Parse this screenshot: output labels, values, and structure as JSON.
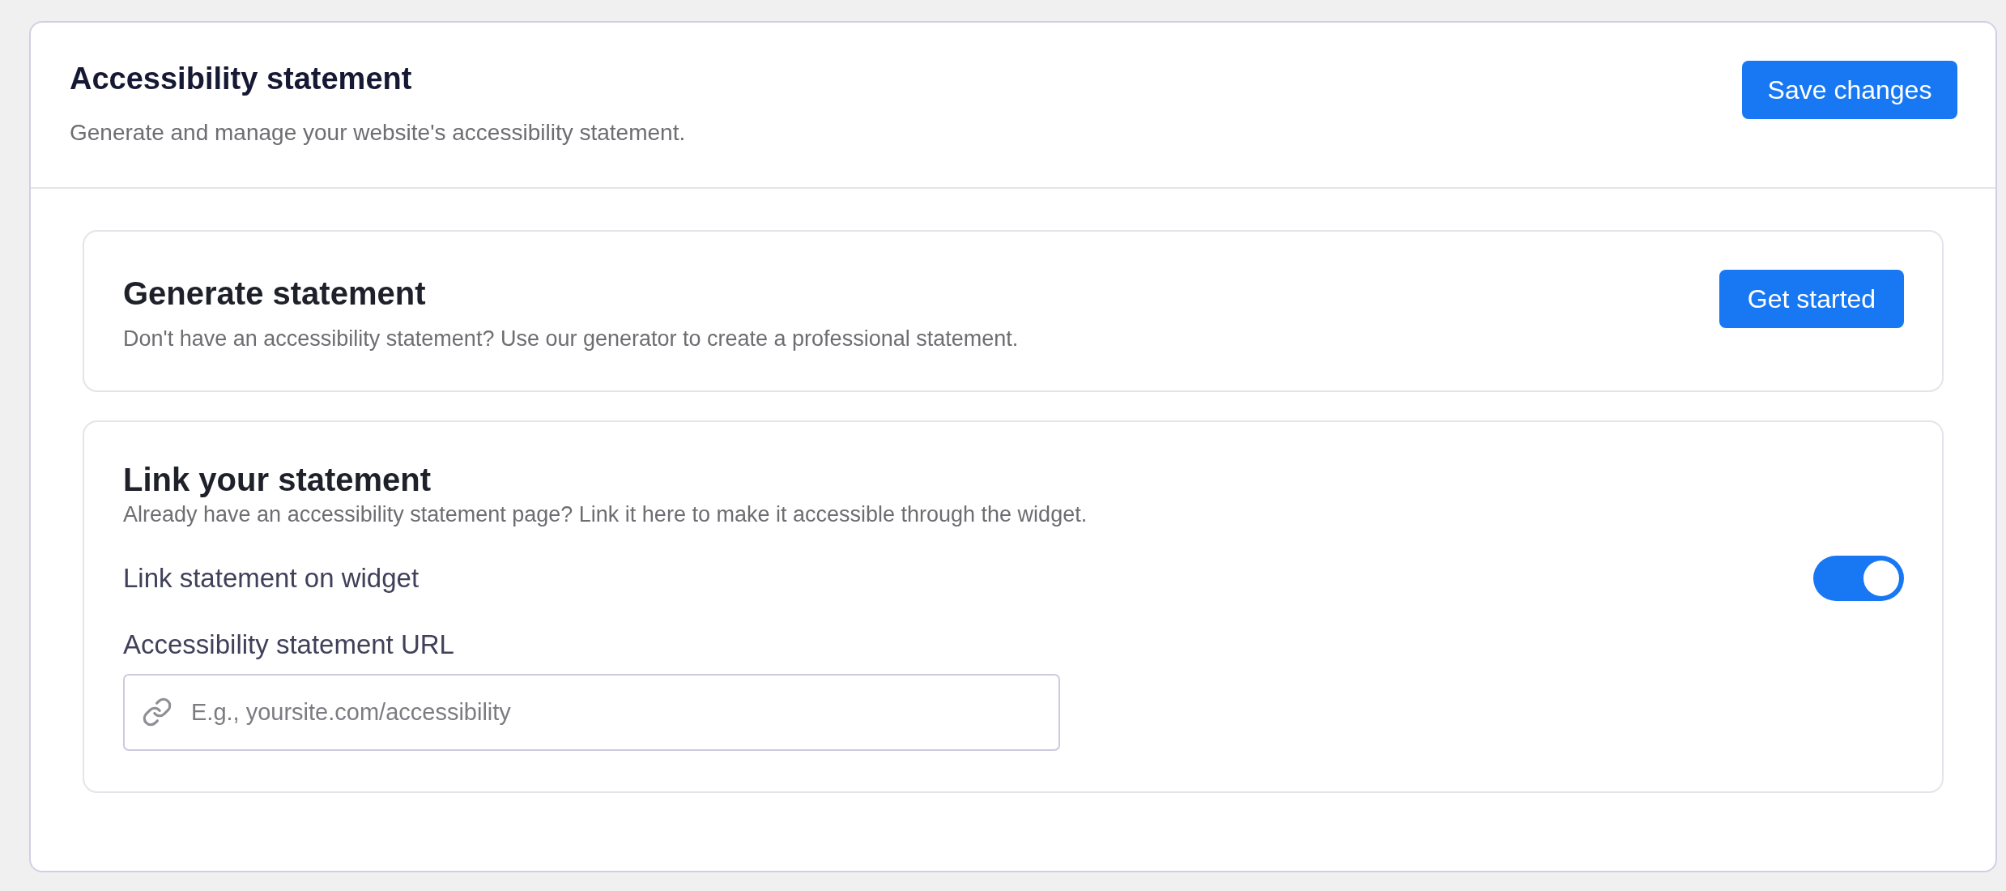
{
  "header": {
    "title": "Accessibility statement",
    "subtitle": "Generate and manage your website's accessibility statement.",
    "save_button": "Save changes"
  },
  "sections": [
    {
      "kind": "action",
      "title": "Generate statement",
      "description": "Don't have an accessibility statement? Use our generator to create a professional statement.",
      "button": "Get started"
    },
    {
      "kind": "link",
      "title": "Link your statement",
      "description": "Already have an accessibility statement page? Link it here to make it accessible through the widget.",
      "toggle": {
        "label": "Link statement on widget",
        "on": true
      },
      "url_field": {
        "label": "Accessibility statement URL",
        "placeholder": "E.g., yoursite.com/accessibility"
      }
    }
  ]
}
